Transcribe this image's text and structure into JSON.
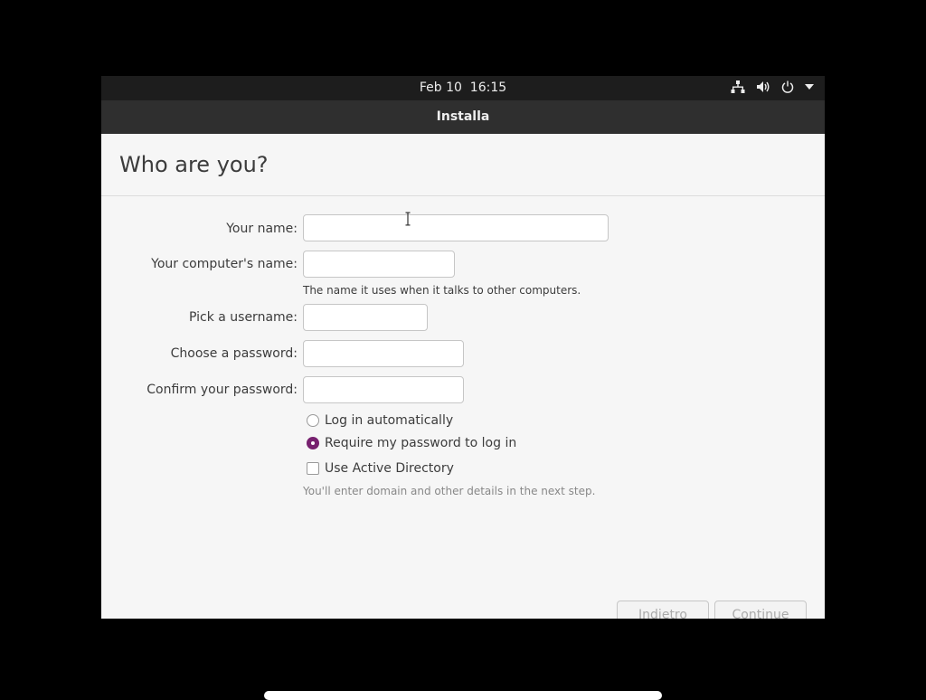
{
  "topbar": {
    "date": "Feb 10",
    "time": "16:15"
  },
  "window": {
    "title": "Installa"
  },
  "page": {
    "heading": "Who are you?"
  },
  "form": {
    "name_label": "Your name:",
    "name_value": "",
    "computer_label": "Your computer's name:",
    "computer_value": "",
    "computer_hint": "The name it uses when it talks to other computers.",
    "username_label": "Pick a username:",
    "username_value": "",
    "password_label": "Choose a password:",
    "confirm_label": "Confirm your password:",
    "login_auto_label": "Log in automatically",
    "login_auto_selected": false,
    "require_password_label": "Require my password to log in",
    "require_password_selected": true,
    "active_directory_label": "Use Active Directory",
    "active_directory_checked": false,
    "active_directory_hint": "You'll enter domain and other details in the next step."
  },
  "buttons": {
    "back": "Indietro",
    "continue": "Continue"
  },
  "colors": {
    "accent": "#77216f",
    "topbar": "#1d1d1d",
    "titlebar": "#2f2f2f"
  },
  "icons": [
    "network-icon",
    "volume-icon",
    "power-icon",
    "dropdown-arrow-icon"
  ]
}
